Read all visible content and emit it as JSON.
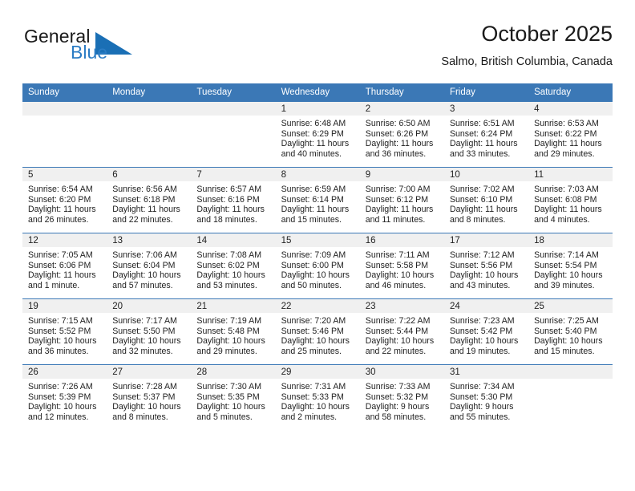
{
  "brand": {
    "name_part1": "General",
    "name_part2": "Blue",
    "triangle_color": "#1a6fb5"
  },
  "header": {
    "title": "October 2025",
    "subtitle": "Salmo, British Columbia, Canada"
  },
  "theme": {
    "header_blue": "#3b78b6",
    "day_strip_grey": "#f0f0f0",
    "text": "#222222"
  },
  "weekday_headers": [
    "Sunday",
    "Monday",
    "Tuesday",
    "Wednesday",
    "Thursday",
    "Friday",
    "Saturday"
  ],
  "labels": {
    "sunrise": "Sunrise:",
    "sunset": "Sunset:",
    "daylight": "Daylight:"
  },
  "weeks": [
    [
      {
        "day": ""
      },
      {
        "day": ""
      },
      {
        "day": ""
      },
      {
        "day": "1",
        "sunrise": "Sunrise: 6:48 AM",
        "sunset": "Sunset: 6:29 PM",
        "daylight_line1": "Daylight: 11 hours",
        "daylight_line2": "and 40 minutes."
      },
      {
        "day": "2",
        "sunrise": "Sunrise: 6:50 AM",
        "sunset": "Sunset: 6:26 PM",
        "daylight_line1": "Daylight: 11 hours",
        "daylight_line2": "and 36 minutes."
      },
      {
        "day": "3",
        "sunrise": "Sunrise: 6:51 AM",
        "sunset": "Sunset: 6:24 PM",
        "daylight_line1": "Daylight: 11 hours",
        "daylight_line2": "and 33 minutes."
      },
      {
        "day": "4",
        "sunrise": "Sunrise: 6:53 AM",
        "sunset": "Sunset: 6:22 PM",
        "daylight_line1": "Daylight: 11 hours",
        "daylight_line2": "and 29 minutes."
      }
    ],
    [
      {
        "day": "5",
        "sunrise": "Sunrise: 6:54 AM",
        "sunset": "Sunset: 6:20 PM",
        "daylight_line1": "Daylight: 11 hours",
        "daylight_line2": "and 26 minutes."
      },
      {
        "day": "6",
        "sunrise": "Sunrise: 6:56 AM",
        "sunset": "Sunset: 6:18 PM",
        "daylight_line1": "Daylight: 11 hours",
        "daylight_line2": "and 22 minutes."
      },
      {
        "day": "7",
        "sunrise": "Sunrise: 6:57 AM",
        "sunset": "Sunset: 6:16 PM",
        "daylight_line1": "Daylight: 11 hours",
        "daylight_line2": "and 18 minutes."
      },
      {
        "day": "8",
        "sunrise": "Sunrise: 6:59 AM",
        "sunset": "Sunset: 6:14 PM",
        "daylight_line1": "Daylight: 11 hours",
        "daylight_line2": "and 15 minutes."
      },
      {
        "day": "9",
        "sunrise": "Sunrise: 7:00 AM",
        "sunset": "Sunset: 6:12 PM",
        "daylight_line1": "Daylight: 11 hours",
        "daylight_line2": "and 11 minutes."
      },
      {
        "day": "10",
        "sunrise": "Sunrise: 7:02 AM",
        "sunset": "Sunset: 6:10 PM",
        "daylight_line1": "Daylight: 11 hours",
        "daylight_line2": "and 8 minutes."
      },
      {
        "day": "11",
        "sunrise": "Sunrise: 7:03 AM",
        "sunset": "Sunset: 6:08 PM",
        "daylight_line1": "Daylight: 11 hours",
        "daylight_line2": "and 4 minutes."
      }
    ],
    [
      {
        "day": "12",
        "sunrise": "Sunrise: 7:05 AM",
        "sunset": "Sunset: 6:06 PM",
        "daylight_line1": "Daylight: 11 hours",
        "daylight_line2": "and 1 minute."
      },
      {
        "day": "13",
        "sunrise": "Sunrise: 7:06 AM",
        "sunset": "Sunset: 6:04 PM",
        "daylight_line1": "Daylight: 10 hours",
        "daylight_line2": "and 57 minutes."
      },
      {
        "day": "14",
        "sunrise": "Sunrise: 7:08 AM",
        "sunset": "Sunset: 6:02 PM",
        "daylight_line1": "Daylight: 10 hours",
        "daylight_line2": "and 53 minutes."
      },
      {
        "day": "15",
        "sunrise": "Sunrise: 7:09 AM",
        "sunset": "Sunset: 6:00 PM",
        "daylight_line1": "Daylight: 10 hours",
        "daylight_line2": "and 50 minutes."
      },
      {
        "day": "16",
        "sunrise": "Sunrise: 7:11 AM",
        "sunset": "Sunset: 5:58 PM",
        "daylight_line1": "Daylight: 10 hours",
        "daylight_line2": "and 46 minutes."
      },
      {
        "day": "17",
        "sunrise": "Sunrise: 7:12 AM",
        "sunset": "Sunset: 5:56 PM",
        "daylight_line1": "Daylight: 10 hours",
        "daylight_line2": "and 43 minutes."
      },
      {
        "day": "18",
        "sunrise": "Sunrise: 7:14 AM",
        "sunset": "Sunset: 5:54 PM",
        "daylight_line1": "Daylight: 10 hours",
        "daylight_line2": "and 39 minutes."
      }
    ],
    [
      {
        "day": "19",
        "sunrise": "Sunrise: 7:15 AM",
        "sunset": "Sunset: 5:52 PM",
        "daylight_line1": "Daylight: 10 hours",
        "daylight_line2": "and 36 minutes."
      },
      {
        "day": "20",
        "sunrise": "Sunrise: 7:17 AM",
        "sunset": "Sunset: 5:50 PM",
        "daylight_line1": "Daylight: 10 hours",
        "daylight_line2": "and 32 minutes."
      },
      {
        "day": "21",
        "sunrise": "Sunrise: 7:19 AM",
        "sunset": "Sunset: 5:48 PM",
        "daylight_line1": "Daylight: 10 hours",
        "daylight_line2": "and 29 minutes."
      },
      {
        "day": "22",
        "sunrise": "Sunrise: 7:20 AM",
        "sunset": "Sunset: 5:46 PM",
        "daylight_line1": "Daylight: 10 hours",
        "daylight_line2": "and 25 minutes."
      },
      {
        "day": "23",
        "sunrise": "Sunrise: 7:22 AM",
        "sunset": "Sunset: 5:44 PM",
        "daylight_line1": "Daylight: 10 hours",
        "daylight_line2": "and 22 minutes."
      },
      {
        "day": "24",
        "sunrise": "Sunrise: 7:23 AM",
        "sunset": "Sunset: 5:42 PM",
        "daylight_line1": "Daylight: 10 hours",
        "daylight_line2": "and 19 minutes."
      },
      {
        "day": "25",
        "sunrise": "Sunrise: 7:25 AM",
        "sunset": "Sunset: 5:40 PM",
        "daylight_line1": "Daylight: 10 hours",
        "daylight_line2": "and 15 minutes."
      }
    ],
    [
      {
        "day": "26",
        "sunrise": "Sunrise: 7:26 AM",
        "sunset": "Sunset: 5:39 PM",
        "daylight_line1": "Daylight: 10 hours",
        "daylight_line2": "and 12 minutes."
      },
      {
        "day": "27",
        "sunrise": "Sunrise: 7:28 AM",
        "sunset": "Sunset: 5:37 PM",
        "daylight_line1": "Daylight: 10 hours",
        "daylight_line2": "and 8 minutes."
      },
      {
        "day": "28",
        "sunrise": "Sunrise: 7:30 AM",
        "sunset": "Sunset: 5:35 PM",
        "daylight_line1": "Daylight: 10 hours",
        "daylight_line2": "and 5 minutes."
      },
      {
        "day": "29",
        "sunrise": "Sunrise: 7:31 AM",
        "sunset": "Sunset: 5:33 PM",
        "daylight_line1": "Daylight: 10 hours",
        "daylight_line2": "and 2 minutes."
      },
      {
        "day": "30",
        "sunrise": "Sunrise: 7:33 AM",
        "sunset": "Sunset: 5:32 PM",
        "daylight_line1": "Daylight: 9 hours",
        "daylight_line2": "and 58 minutes."
      },
      {
        "day": "31",
        "sunrise": "Sunrise: 7:34 AM",
        "sunset": "Sunset: 5:30 PM",
        "daylight_line1": "Daylight: 9 hours",
        "daylight_line2": "and 55 minutes."
      },
      {
        "day": ""
      }
    ]
  ]
}
